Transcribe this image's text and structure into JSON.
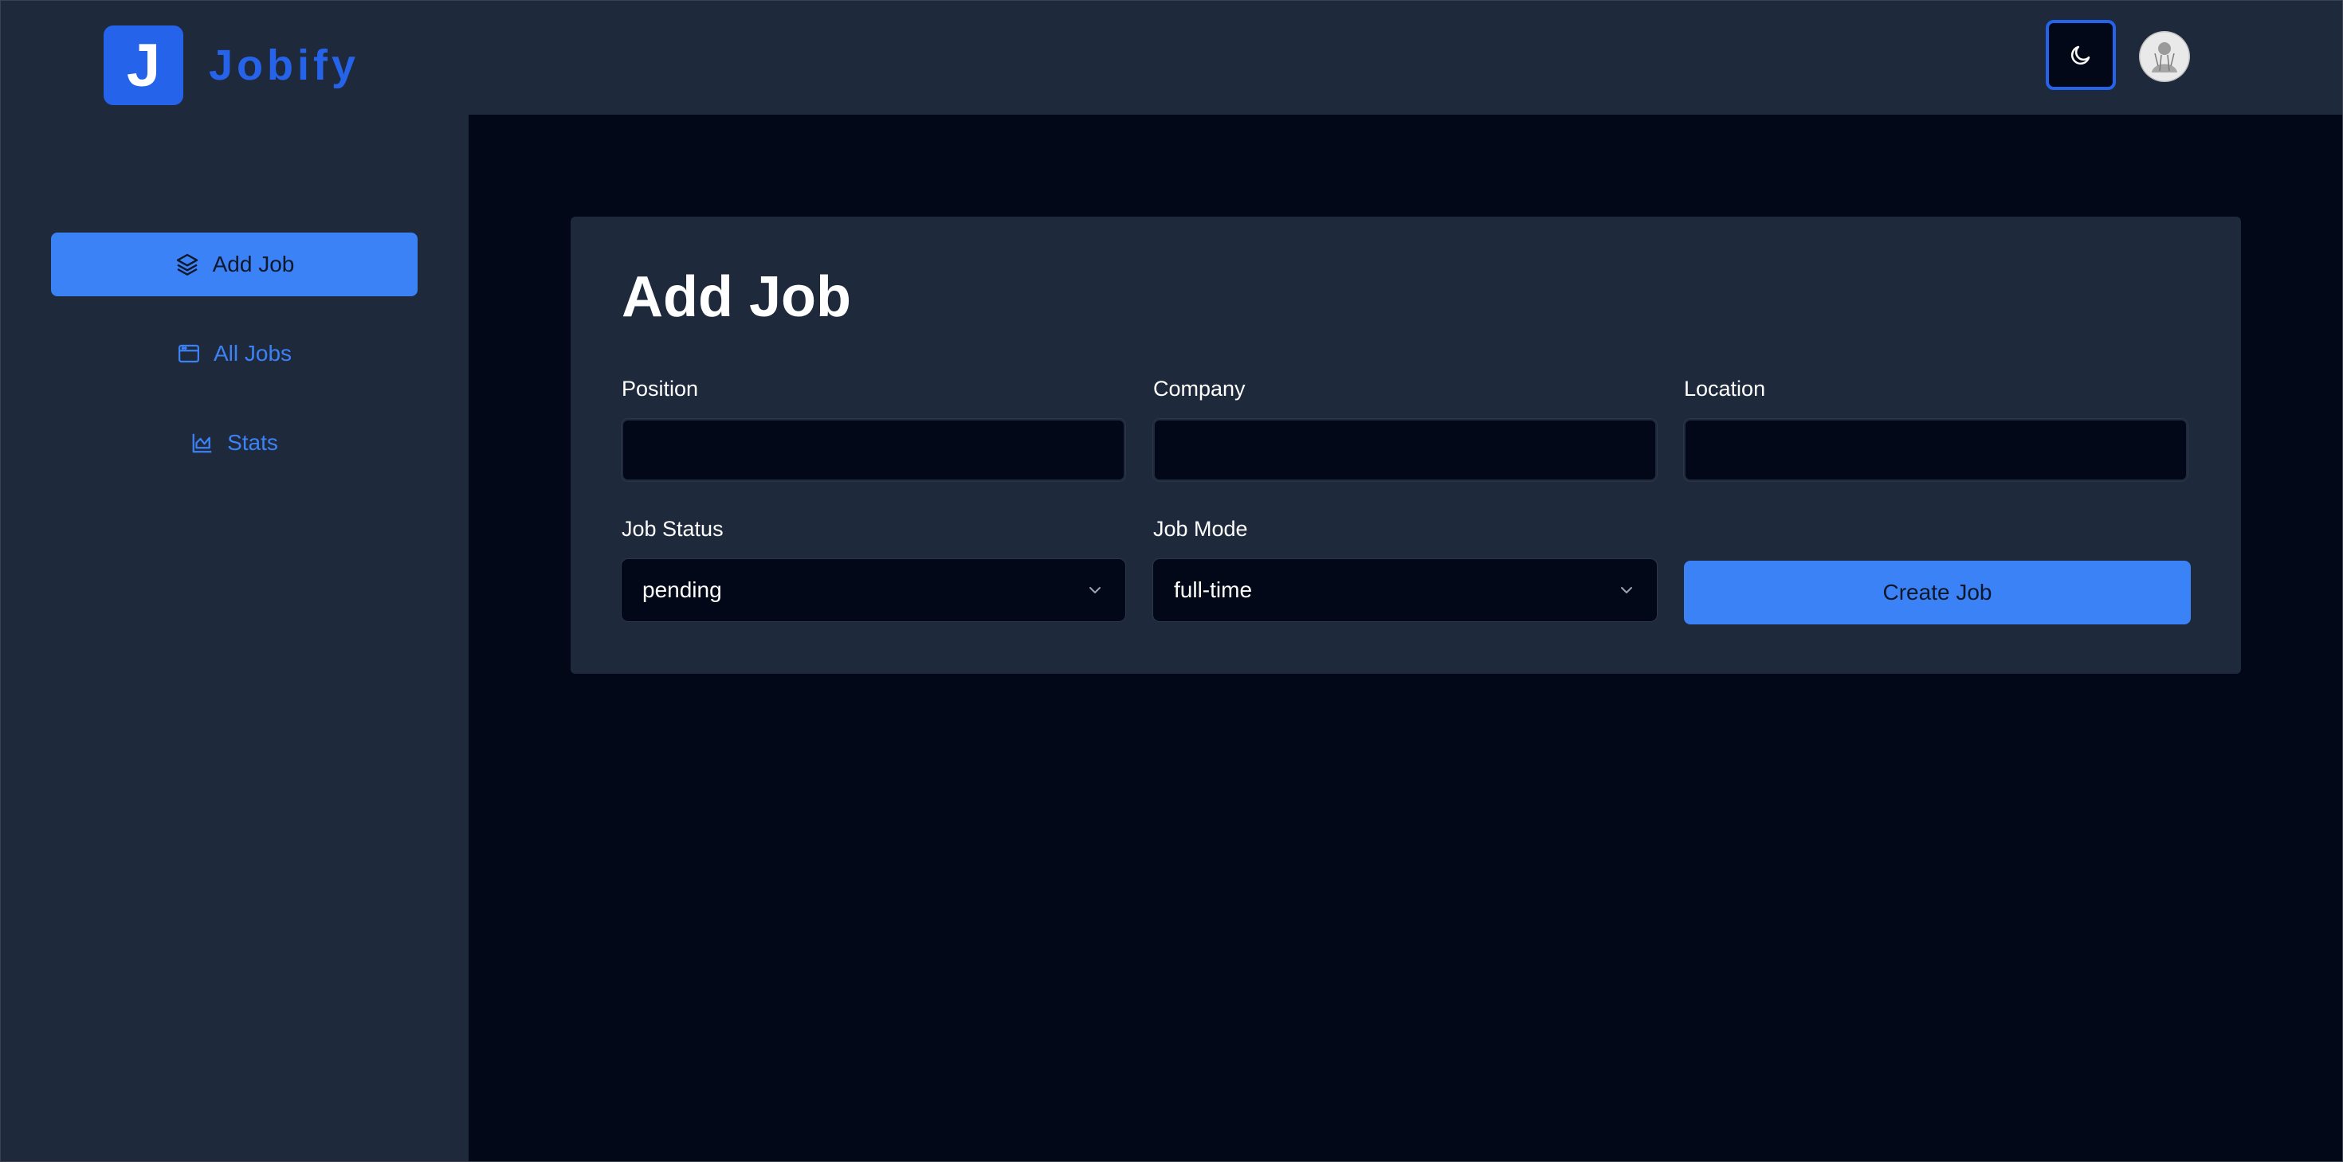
{
  "app": {
    "logo_letter": "J",
    "name": "Jobify"
  },
  "sidebar": {
    "items": [
      {
        "label": "Add Job",
        "icon": "layers-icon",
        "active": true
      },
      {
        "label": "All Jobs",
        "icon": "browser-window-icon",
        "active": false
      },
      {
        "label": "Stats",
        "icon": "area-chart-icon",
        "active": false
      }
    ]
  },
  "header": {
    "theme_toggle_icon": "moon-icon",
    "avatar_icon": "user-avatar"
  },
  "form": {
    "title": "Add Job",
    "position": {
      "label": "Position",
      "value": ""
    },
    "company": {
      "label": "Company",
      "value": ""
    },
    "location": {
      "label": "Location",
      "value": ""
    },
    "job_status": {
      "label": "Job Status",
      "value": "pending"
    },
    "job_mode": {
      "label": "Job Mode",
      "value": "full-time"
    },
    "submit_label": "Create Job"
  },
  "colors": {
    "accent": "#3b82f6",
    "brand": "#2563eb",
    "panel": "#1e293b",
    "background": "#020817"
  }
}
